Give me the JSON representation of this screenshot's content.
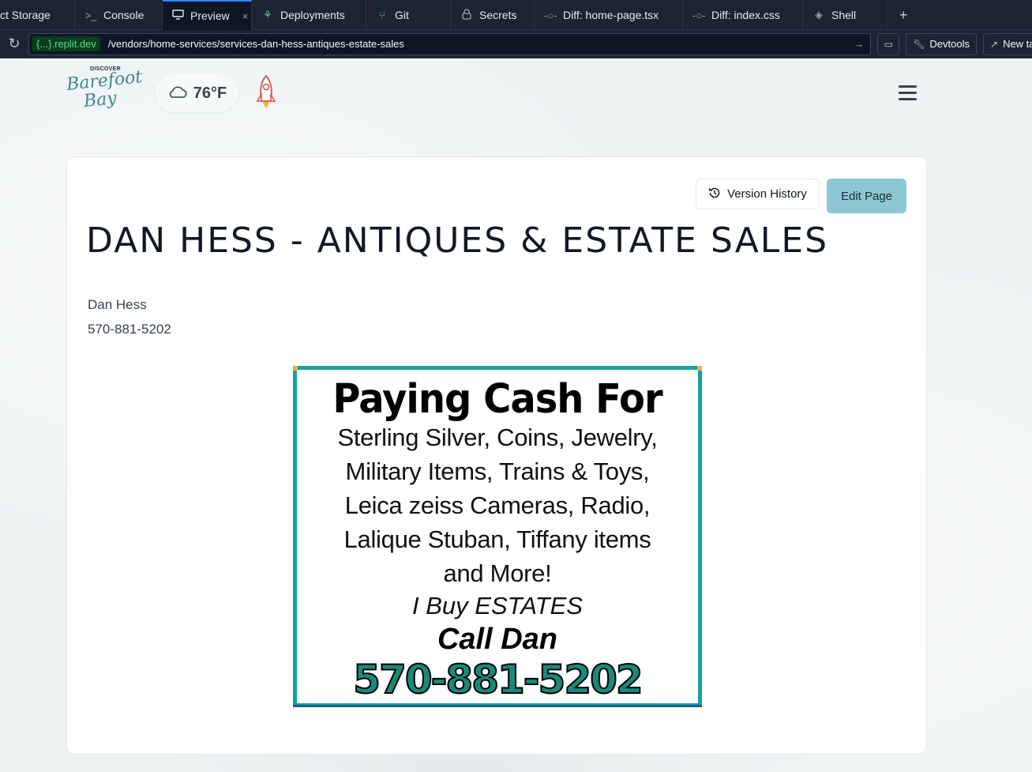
{
  "ide": {
    "tabs": [
      {
        "label": "ct Storage",
        "icon": ""
      },
      {
        "label": "Console",
        "icon": "terminal-icon"
      },
      {
        "label": "Preview",
        "icon": "monitor-icon",
        "active": true
      },
      {
        "label": "Deployments",
        "icon": "deploy-icon"
      },
      {
        "label": "Git",
        "icon": "git-branch-icon"
      },
      {
        "label": "Secrets",
        "icon": "lock-icon"
      },
      {
        "label": "Diff: home-page.tsx",
        "icon": "diff-icon"
      },
      {
        "label": "Diff: index.css",
        "icon": "diff-icon"
      },
      {
        "label": "Shell",
        "icon": "shell-icon"
      }
    ],
    "tab_close_symbol": "×",
    "add_tab_symbol": "+",
    "url": {
      "domain": "{...}.replit.dev",
      "path": "/vendors/home-services/services-dan-hess-antiques-estate-sales"
    },
    "devtools_label": "Devtools",
    "new_tab_label": "New ta"
  },
  "site": {
    "logo": {
      "top": "DISCOVER",
      "line1": "Barefoot",
      "line2": "Bay"
    },
    "weather": {
      "temperature": "76°F",
      "icon": "cloud-icon"
    },
    "version_history_label": "Version History",
    "edit_page_label": "Edit Page",
    "title": "Dan Hess - Antiques & Estate Sales",
    "contact_name": "Dan Hess",
    "contact_phone": "570-881-5202",
    "ad": {
      "headline": "Paying Cash For",
      "lines": [
        "Sterling Silver, Coins, Jewelry,",
        "Military Items, Trains & Toys,",
        "Leica zeiss Cameras, Radio,",
        "Lalique Stuban, Tiffany items",
        "and More!"
      ],
      "italic_line": "I Buy ESTATES",
      "call_line": "Call Dan",
      "phone": "570-881-5202"
    }
  },
  "colors": {
    "accent_teal": "#17a2a2",
    "edit_button": "#8dc7d3",
    "phone_green": "#178a7a",
    "ide_bg": "#1c2333"
  }
}
